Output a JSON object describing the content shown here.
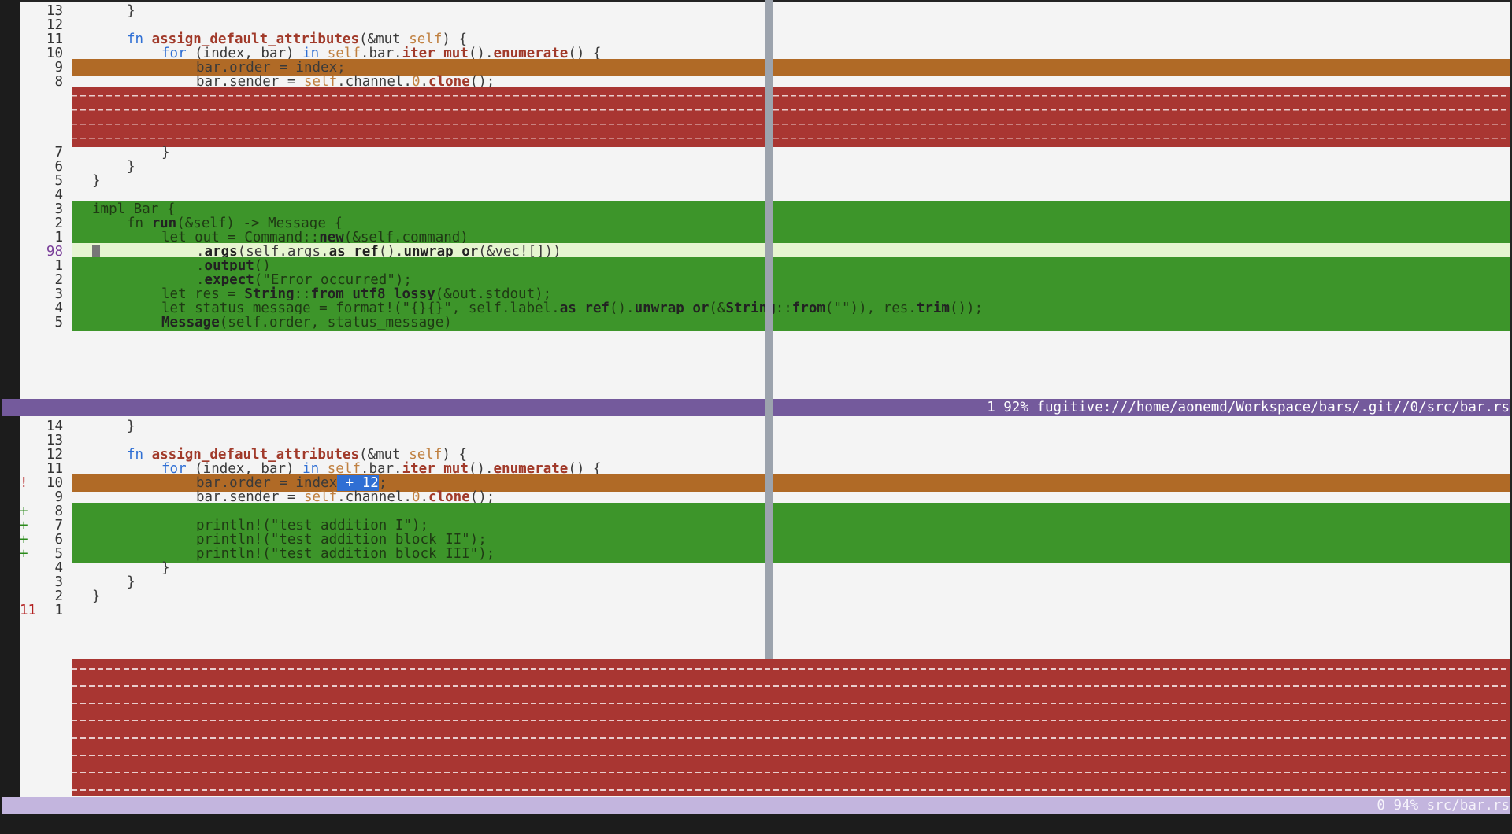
{
  "top_pane": {
    "lines": [
      {
        "sign": "",
        "num": "13",
        "kind": "normal",
        "indent": 1,
        "segments": [
          {
            "t": "}"
          }
        ]
      },
      {
        "sign": "",
        "num": "12",
        "kind": "normal",
        "indent": 0,
        "segments": []
      },
      {
        "sign": "",
        "num": "11",
        "kind": "normal",
        "indent": 1,
        "segments": [
          {
            "t": "fn ",
            "c": "kw"
          },
          {
            "t": "assign_default_attributes",
            "c": "fn"
          },
          {
            "t": "(&mut "
          },
          {
            "t": "self",
            "c": "sf"
          },
          {
            "t": ") {"
          }
        ]
      },
      {
        "sign": "",
        "num": "10",
        "kind": "normal",
        "indent": 2,
        "segments": [
          {
            "t": "for",
            "c": "kw"
          },
          {
            "t": " (index, bar) "
          },
          {
            "t": "in",
            "c": "kw"
          },
          {
            "t": " "
          },
          {
            "t": "self",
            "c": "sf"
          },
          {
            "t": ".bar."
          },
          {
            "t": "iter_mut",
            "c": "fn"
          },
          {
            "t": "()."
          },
          {
            "t": "enumerate",
            "c": "fn"
          },
          {
            "t": "() {"
          }
        ]
      },
      {
        "sign": "",
        "num": "9",
        "kind": "changed",
        "indent": 3,
        "segments": [
          {
            "t": "bar.order = index;"
          }
        ]
      },
      {
        "sign": "",
        "num": "8",
        "kind": "normal",
        "indent": 3,
        "segments": [
          {
            "t": "bar.sender = "
          },
          {
            "t": "self",
            "c": "sf"
          },
          {
            "t": ".channel."
          },
          {
            "t": "0",
            "c": "sf"
          },
          {
            "t": "."
          },
          {
            "t": "clone",
            "c": "fn"
          },
          {
            "t": "();"
          }
        ]
      },
      {
        "sign": "",
        "num": "",
        "kind": "deleted",
        "indent": 0,
        "segments": []
      },
      {
        "sign": "",
        "num": "",
        "kind": "deleted",
        "indent": 0,
        "segments": []
      },
      {
        "sign": "",
        "num": "",
        "kind": "deleted",
        "indent": 0,
        "segments": []
      },
      {
        "sign": "",
        "num": "",
        "kind": "deleted",
        "indent": 0,
        "segments": []
      },
      {
        "sign": "",
        "num": "7",
        "kind": "normal",
        "indent": 2,
        "segments": [
          {
            "t": "}"
          }
        ]
      },
      {
        "sign": "",
        "num": "6",
        "kind": "normal",
        "indent": 1,
        "segments": [
          {
            "t": "}"
          }
        ]
      },
      {
        "sign": "",
        "num": "5",
        "kind": "normal",
        "indent": 0,
        "segments": [
          {
            "t": "}"
          }
        ]
      },
      {
        "sign": "",
        "num": "4",
        "kind": "normal",
        "indent": 0,
        "segments": []
      },
      {
        "sign": "",
        "num": "3",
        "kind": "added",
        "indent": 0,
        "segments": [
          {
            "t": "impl Bar {"
          }
        ]
      },
      {
        "sign": "",
        "num": "2",
        "kind": "added",
        "indent": 1,
        "segments": [
          {
            "t": "fn "
          },
          {
            "t": "run",
            "c": "fnb"
          },
          {
            "t": "(&self) -> Message {"
          }
        ]
      },
      {
        "sign": "",
        "num": "1",
        "kind": "added",
        "indent": 2,
        "segments": [
          {
            "t": "let out = Command::"
          },
          {
            "t": "new",
            "c": "fnb"
          },
          {
            "t": "(&self.command)"
          }
        ]
      },
      {
        "sign": "",
        "num": "98",
        "kind": "addtext",
        "indent": 3,
        "cursor": true,
        "segments": [
          {
            "t": "."
          },
          {
            "t": "args",
            "c": "fnb"
          },
          {
            "t": "(self.args."
          },
          {
            "t": "as_ref",
            "c": "fnb"
          },
          {
            "t": "()."
          },
          {
            "t": "unwrap_or",
            "c": "fnb"
          },
          {
            "t": "(&vec![]))"
          }
        ]
      },
      {
        "sign": "",
        "num": "1",
        "kind": "added",
        "indent": 3,
        "segments": [
          {
            "t": "."
          },
          {
            "t": "output",
            "c": "fnb"
          },
          {
            "t": "()"
          }
        ]
      },
      {
        "sign": "",
        "num": "2",
        "kind": "added",
        "indent": 3,
        "segments": [
          {
            "t": "."
          },
          {
            "t": "expect",
            "c": "fnb"
          },
          {
            "t": "(\"Error occurred\");"
          }
        ]
      },
      {
        "sign": "",
        "num": "3",
        "kind": "added",
        "indent": 2,
        "segments": [
          {
            "t": "let res = "
          },
          {
            "t": "String",
            "c": "fnb"
          },
          {
            "t": "::"
          },
          {
            "t": "from_utf8_lossy",
            "c": "fnb"
          },
          {
            "t": "(&out.stdout);"
          }
        ]
      },
      {
        "sign": "",
        "num": "4",
        "kind": "added",
        "indent": 2,
        "segments": [
          {
            "t": "let status_message = format!(\"{}{}\", self.label."
          },
          {
            "t": "as_ref",
            "c": "fnb"
          },
          {
            "t": "()."
          },
          {
            "t": "unwrap_or",
            "c": "fnb"
          },
          {
            "t": "(&"
          },
          {
            "t": "String",
            "c": "fnb"
          },
          {
            "t": "::"
          },
          {
            "t": "from",
            "c": "fnb"
          },
          {
            "t": "(\"\")), res."
          },
          {
            "t": "trim",
            "c": "fnb"
          },
          {
            "t": "());"
          }
        ]
      },
      {
        "sign": "",
        "num": "5",
        "kind": "added",
        "indent": 2,
        "segments": [
          {
            "t": "Message",
            "c": "fnb"
          },
          {
            "t": "(self.order, status_message)"
          }
        ]
      }
    ],
    "status": "1 92% fugitive:///home/aonemd/Workspace/bars/.git//0/src/bar.rs"
  },
  "bottom_pane": {
    "lines": [
      {
        "sign": "",
        "num": "14",
        "kind": "normal",
        "indent": 1,
        "segments": [
          {
            "t": "}"
          }
        ]
      },
      {
        "sign": "",
        "num": "13",
        "kind": "normal",
        "indent": 0,
        "segments": []
      },
      {
        "sign": "",
        "num": "12",
        "kind": "normal",
        "indent": 1,
        "segments": [
          {
            "t": "fn ",
            "c": "kw"
          },
          {
            "t": "assign_default_attributes",
            "c": "fn"
          },
          {
            "t": "(&mut "
          },
          {
            "t": "self",
            "c": "sf"
          },
          {
            "t": ") {"
          }
        ]
      },
      {
        "sign": "",
        "num": "11",
        "kind": "normal",
        "indent": 2,
        "segments": [
          {
            "t": "for",
            "c": "kw"
          },
          {
            "t": " (index, bar) "
          },
          {
            "t": "in",
            "c": "kw"
          },
          {
            "t": " "
          },
          {
            "t": "self",
            "c": "sf"
          },
          {
            "t": ".bar."
          },
          {
            "t": "iter_mut",
            "c": "fn"
          },
          {
            "t": "()."
          },
          {
            "t": "enumerate",
            "c": "fn"
          },
          {
            "t": "() {"
          }
        ]
      },
      {
        "sign": "!",
        "num": "10",
        "kind": "changed",
        "indent": 3,
        "segments": [
          {
            "t": "bar.order = index"
          },
          {
            "t": " + 12",
            "c": "sel"
          },
          {
            "t": ";"
          }
        ]
      },
      {
        "sign": "",
        "num": "9",
        "kind": "normal",
        "indent": 3,
        "segments": [
          {
            "t": "bar.sender = "
          },
          {
            "t": "self",
            "c": "sf"
          },
          {
            "t": ".channel."
          },
          {
            "t": "0",
            "c": "sf"
          },
          {
            "t": "."
          },
          {
            "t": "clone",
            "c": "fn"
          },
          {
            "t": "();"
          }
        ]
      },
      {
        "sign": "+",
        "num": "8",
        "kind": "added",
        "indent": 0,
        "segments": []
      },
      {
        "sign": "+",
        "num": "7",
        "kind": "added",
        "indent": 3,
        "segments": [
          {
            "t": "println!(\"test addition I\");"
          }
        ]
      },
      {
        "sign": "+",
        "num": "6",
        "kind": "added",
        "indent": 3,
        "segments": [
          {
            "t": "println!(\"test addition block II\");"
          }
        ]
      },
      {
        "sign": "+",
        "num": "5",
        "kind": "added",
        "indent": 3,
        "segments": [
          {
            "t": "println!(\"test addition block III\");"
          }
        ]
      },
      {
        "sign": "",
        "num": "4",
        "kind": "normal",
        "indent": 2,
        "segments": [
          {
            "t": "}"
          }
        ]
      },
      {
        "sign": "",
        "num": "3",
        "kind": "normal",
        "indent": 1,
        "segments": [
          {
            "t": "}"
          }
        ]
      },
      {
        "sign": "",
        "num": "2",
        "kind": "normal",
        "indent": 0,
        "segments": [
          {
            "t": "}"
          }
        ]
      },
      {
        "sign": "11",
        "num": "1",
        "kind": "normal",
        "indent": 0,
        "segments": []
      }
    ],
    "deleted_block_rows": 8,
    "status": "0 94% src/bar.rs"
  },
  "colors": {
    "added": "#3d952a",
    "changed": "#b06a26",
    "deleted": "#a93632",
    "status_active": "#745a9c",
    "status_inactive": "#c3b5de",
    "keyword": "#2f6fd4",
    "function": "#a13a2a"
  }
}
